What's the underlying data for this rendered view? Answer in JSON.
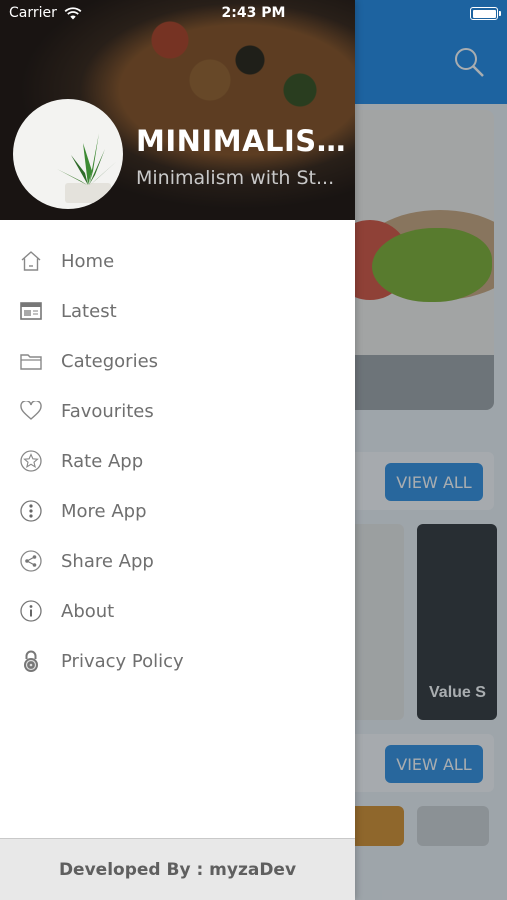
{
  "status_bar": {
    "carrier": "Carrier",
    "time": "2:43 PM"
  },
  "drawer": {
    "header": {
      "title": "MINIMALIST...",
      "subtitle": "Minimalism with St..."
    },
    "menu": [
      {
        "label": "Home",
        "icon": "home-icon"
      },
      {
        "label": "Latest",
        "icon": "latest-icon"
      },
      {
        "label": "Categories",
        "icon": "folder-icon"
      },
      {
        "label": "Favourites",
        "icon": "heart-icon"
      },
      {
        "label": "Rate App",
        "icon": "star-icon"
      },
      {
        "label": "More App",
        "icon": "more-icon"
      },
      {
        "label": "Share App",
        "icon": "share-icon"
      },
      {
        "label": "About",
        "icon": "info-icon"
      },
      {
        "label": "Privacy Policy",
        "icon": "lock-icon"
      }
    ],
    "footer": "Developed By : myzaDev"
  },
  "background": {
    "view_all_1": "VIEW ALL",
    "view_all_2": "VIEW ALL",
    "thumb_label": "Value S"
  },
  "colors": {
    "topbar": "#1e88e5",
    "menu_text": "#6f6f6f",
    "footer_bg": "#e8e8e8"
  }
}
